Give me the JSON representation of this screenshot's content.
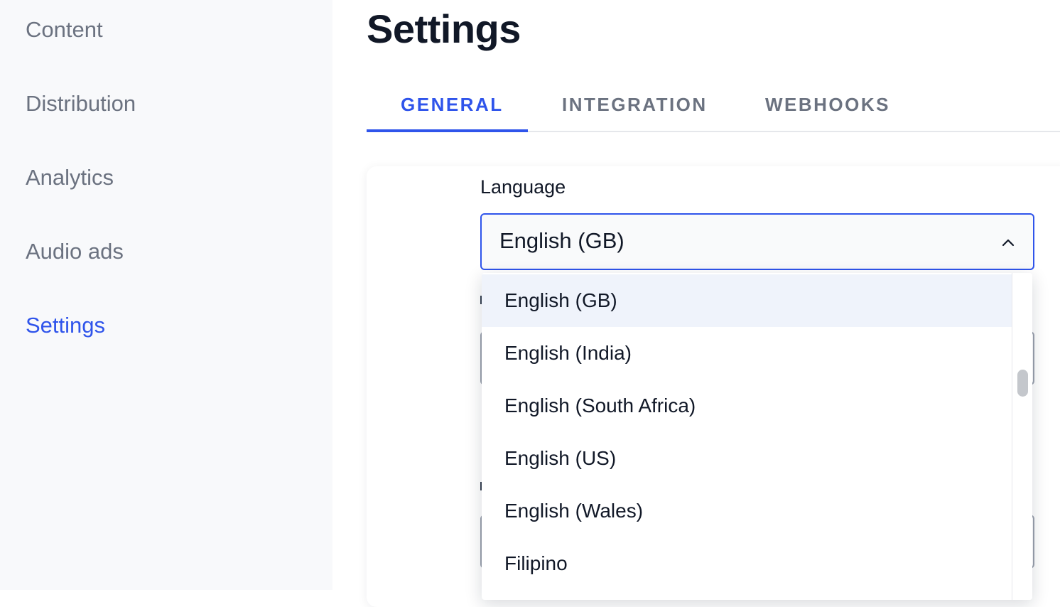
{
  "sidebar": {
    "items": [
      {
        "label": "Content",
        "active": false
      },
      {
        "label": "Distribution",
        "active": false
      },
      {
        "label": "Analytics",
        "active": false
      },
      {
        "label": "Audio ads",
        "active": false
      },
      {
        "label": "Settings",
        "active": true
      }
    ]
  },
  "header": {
    "title": "Settings"
  },
  "tabs": [
    {
      "label": "GENERAL",
      "active": true
    },
    {
      "label": "INTEGRATION",
      "active": false
    },
    {
      "label": "WEBHOOKS",
      "active": false
    }
  ],
  "language_field": {
    "label": "Language",
    "value": "English (GB)",
    "expanded": true,
    "chevron_icon": "chevron-up-icon",
    "options": [
      {
        "label": "English (GB)",
        "selected": true
      },
      {
        "label": "English (India)",
        "selected": false
      },
      {
        "label": "English (South Africa)",
        "selected": false
      },
      {
        "label": "English (US)",
        "selected": false
      },
      {
        "label": "English (Wales)",
        "selected": false
      },
      {
        "label": "Filipino",
        "selected": false
      }
    ]
  },
  "colors": {
    "accent": "#2f54eb",
    "sidebar_bg": "#f8f9fb",
    "muted_text": "#6b7280",
    "text": "#111827",
    "selected_option_bg": "#eff3fb"
  }
}
